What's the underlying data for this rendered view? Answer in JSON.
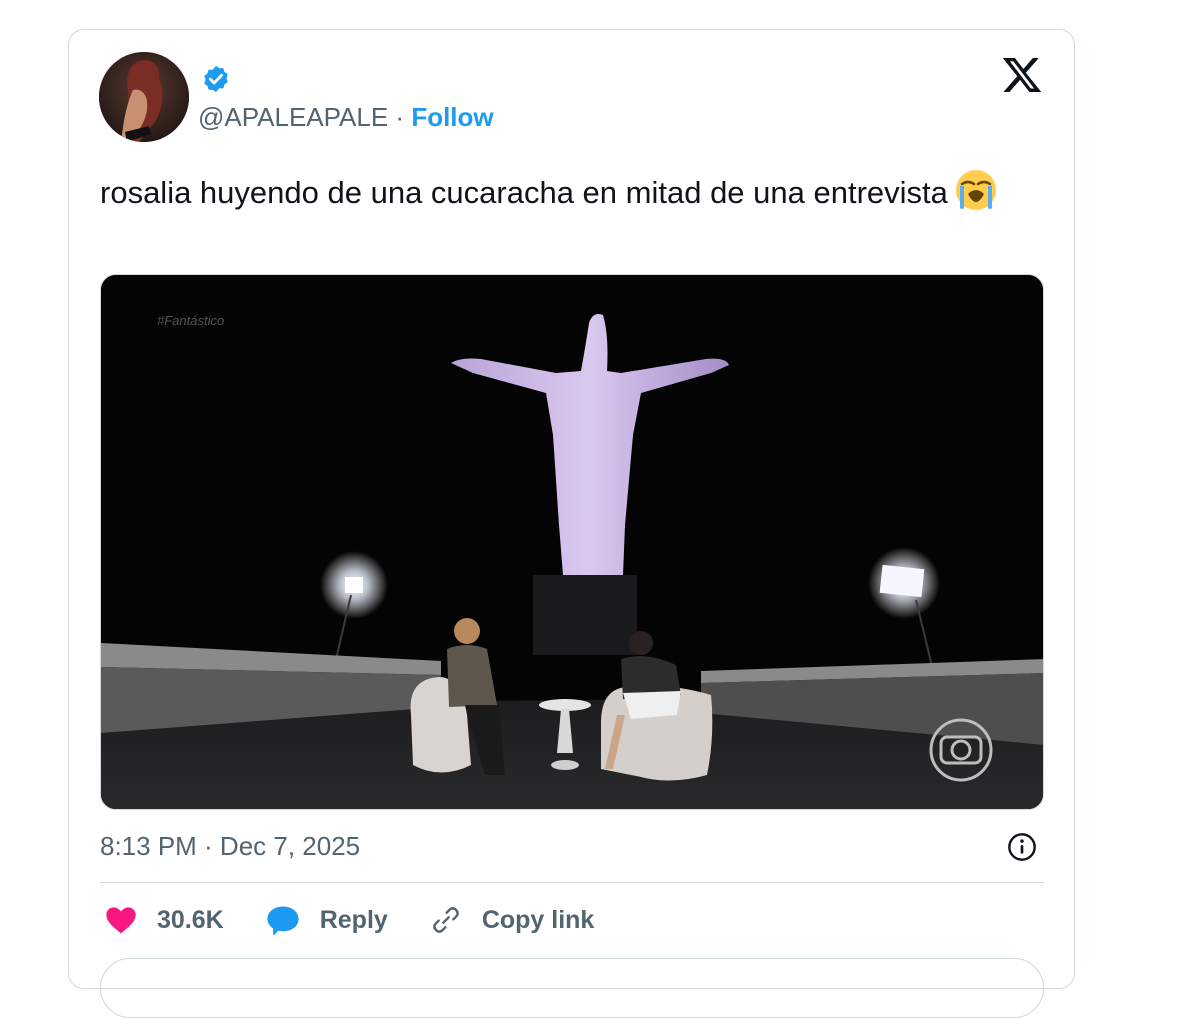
{
  "tweet": {
    "handle": "@APALEAPALE",
    "separator": " · ",
    "follow_label": "Follow",
    "text": "rosalia huyendo de una cucaracha en mitad de una entrevista",
    "emoji": "loudly-crying-face",
    "media": {
      "watermark": "#Fantástico"
    },
    "timestamp": "8:13 PM · Dec 7, 2025",
    "actions": {
      "like_count": "30.6K",
      "reply_label": "Reply",
      "copy_link_label": "Copy link"
    }
  },
  "icons": {
    "verified": "verified-badge-icon",
    "brand": "x-logo-icon",
    "info": "info-icon",
    "like": "heart-icon",
    "reply": "speech-bubble-icon",
    "copy": "link-icon"
  },
  "colors": {
    "accent": "#1d9bf0",
    "like": "#f91880",
    "secondary_text": "#536471",
    "border": "#cfd9de"
  }
}
